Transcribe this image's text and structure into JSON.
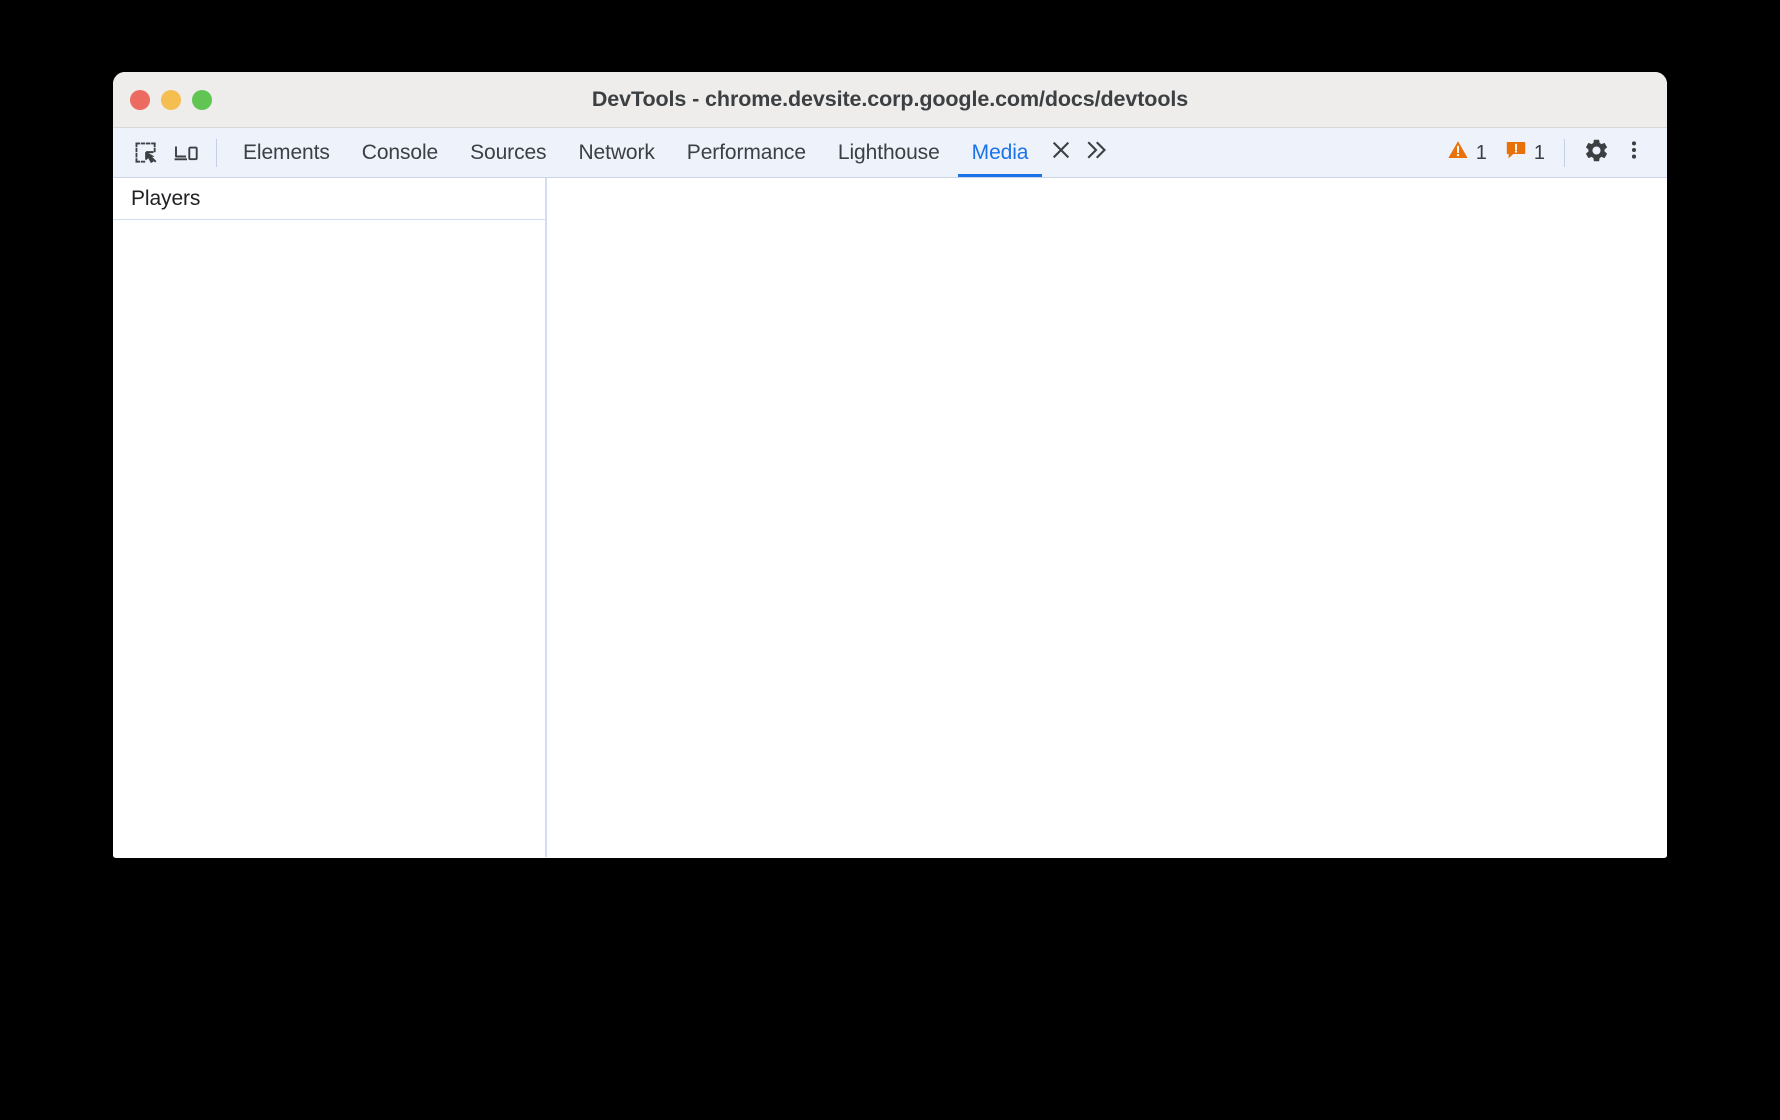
{
  "window": {
    "title": "DevTools - chrome.devsite.corp.google.com/docs/devtools",
    "traffic_lights": {
      "close": "close-window",
      "minimize": "minimize-window",
      "maximize": "maximize-window"
    }
  },
  "toolbar": {
    "inspect_icon": "inspect-element-icon",
    "device_toolbar_icon": "device-toolbar-icon",
    "tabs": [
      {
        "label": "Elements",
        "active": false
      },
      {
        "label": "Console",
        "active": false
      },
      {
        "label": "Sources",
        "active": false
      },
      {
        "label": "Network",
        "active": false
      },
      {
        "label": "Performance",
        "active": false
      },
      {
        "label": "Lighthouse",
        "active": false
      },
      {
        "label": "Media",
        "active": true
      }
    ],
    "close_tab_icon": "close-icon",
    "more_tabs_icon": "chevron-double-right-icon",
    "warnings": {
      "icon": "warning-triangle-icon",
      "count": "1",
      "color": "#e8710a"
    },
    "issues": {
      "icon": "issue-icon",
      "count": "1",
      "color": "#e8710a"
    },
    "settings_icon": "gear-icon",
    "menu_icon": "more-vertical-icon"
  },
  "sidebar": {
    "header_title": "Players",
    "items": []
  },
  "main": {
    "content": ""
  },
  "colors": {
    "accent": "#1a73e8",
    "toolbar_bg": "#eef2fb",
    "titlebar_bg": "#eeedeb",
    "text": "#3c4043",
    "border": "#d3dcf3",
    "page_bg": "#000000"
  }
}
